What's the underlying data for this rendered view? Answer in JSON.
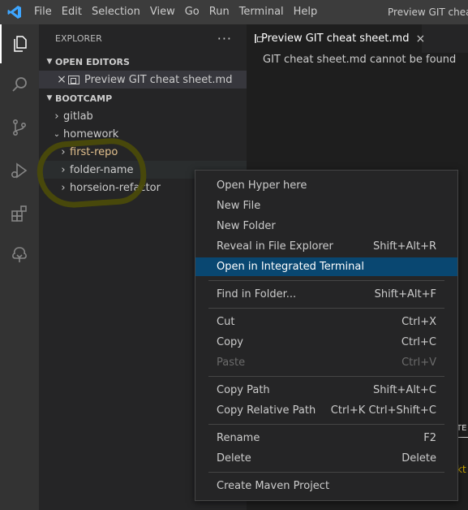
{
  "titlebar": {
    "menus": [
      "File",
      "Edit",
      "Selection",
      "View",
      "Go",
      "Run",
      "Terminal",
      "Help"
    ],
    "window_title": "Preview GIT cheat s",
    "logo_icon": "vscode-logo-icon",
    "logo_color": "#0065a9"
  },
  "activitybar": {
    "items": [
      "explorer-icon",
      "search-icon",
      "source-control-icon",
      "run-debug-icon",
      "extensions-icon",
      "remote-tree-icon"
    ]
  },
  "sidebar": {
    "title": "EXPLORER",
    "more": "···",
    "open_editors_header": "OPEN EDITORS",
    "open_editor_item": "Preview GIT cheat sheet.md",
    "workspace_header": "BOOTCAMP",
    "tree": {
      "gitlab": "gitlab",
      "homework": "homework",
      "first_repo": "first-repo",
      "folder_name": "folder-name",
      "horseion": "horseion-refactor"
    }
  },
  "editor": {
    "tab_label": "Preview GIT cheat sheet.md",
    "message": "GIT cheat sheet.md cannot be found"
  },
  "panel": {
    "tab_fragment": "TE",
    "text_fragment": "kt"
  },
  "context_menu": {
    "items": [
      {
        "label": "Open Hyper here",
        "shortcut": ""
      },
      {
        "label": "New File",
        "shortcut": ""
      },
      {
        "label": "New Folder",
        "shortcut": ""
      },
      {
        "label": "Reveal in File Explorer",
        "shortcut": "Shift+Alt+R"
      },
      {
        "label": "Open in Integrated Terminal",
        "shortcut": ""
      },
      {
        "label": "Find in Folder...",
        "shortcut": "Shift+Alt+F"
      },
      {
        "label": "Cut",
        "shortcut": "Ctrl+X"
      },
      {
        "label": "Copy",
        "shortcut": "Ctrl+C"
      },
      {
        "label": "Paste",
        "shortcut": "Ctrl+V"
      },
      {
        "label": "Copy Path",
        "shortcut": "Shift+Alt+C"
      },
      {
        "label": "Copy Relative Path",
        "shortcut": "Ctrl+K Ctrl+Shift+C"
      },
      {
        "label": "Rename",
        "shortcut": "F2"
      },
      {
        "label": "Delete",
        "shortcut": "Delete"
      },
      {
        "label": "Create Maven Project",
        "shortcut": ""
      }
    ]
  },
  "colors": {
    "highlight": "#094771",
    "accent": "#007acc"
  }
}
